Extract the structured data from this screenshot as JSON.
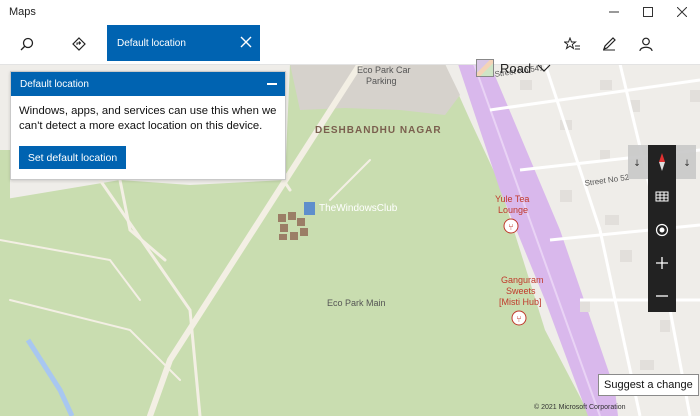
{
  "window": {
    "title": "Maps",
    "minimize_icon": "minimize-icon",
    "maximize_icon": "maximize-icon",
    "close_icon": "close-icon"
  },
  "toolbar": {
    "search_icon": "search-icon",
    "directions_icon": "directions-icon",
    "search_tab_label": "Default location",
    "road_label": "Road",
    "favorites_icon": "favorites-icon",
    "ink_icon": "pen-icon",
    "account_icon": "person-icon"
  },
  "panel": {
    "header": "Default location",
    "body": "Windows, apps, and services can use this when we can't detect a more exact location on this device.",
    "button": "Set default location"
  },
  "map": {
    "labels": {
      "eco_park_car_1": "Eco Park Car",
      "eco_park_car_2": "Parking",
      "deshbandhu": "DESHBANDHU NAGAR",
      "watermark": "TheWindowsClub",
      "street_541": "Street No 541",
      "street_52": "Street No 52",
      "yule_1": "Yule Tea",
      "yule_2": "Lounge",
      "ganguram_1": "Ganguram",
      "ganguram_2": "Sweets",
      "ganguram_3": "[Misti Hub]",
      "eco_park_main": "Eco Park Main"
    },
    "colors": {
      "park": "#c9ddb0",
      "urban": "#efede9",
      "road_purple": "#d9b8ec",
      "water": "#a8c7f0",
      "accent": "#0063b1"
    }
  },
  "controls": {
    "suggest_label": "Suggest a change",
    "copyright": "© 2021 Microsoft Corporation"
  }
}
